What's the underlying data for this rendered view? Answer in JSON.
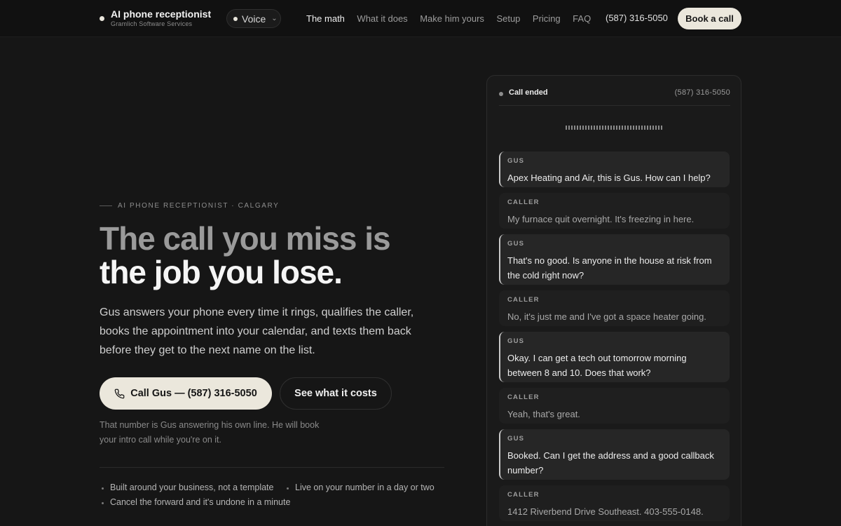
{
  "brand": {
    "title": "AI phone receptionist",
    "subtitle": "Gramlich Software Services"
  },
  "mode": {
    "label": "Voice",
    "chevron_icon": "chevron-down-icon"
  },
  "nav": {
    "links": [
      "The math",
      "What it does",
      "Make him yours",
      "Setup",
      "Pricing",
      "FAQ"
    ],
    "active": "The math",
    "phone": "(587) 316-5050",
    "book_label": "Book a call"
  },
  "hero": {
    "eyebrow": "AI PHONE RECEPTIONIST · CALGARY",
    "headline_line1": "The call you miss is",
    "headline_line2": "the job you lose.",
    "lede": "Gus answers your phone every time it rings, qualifies the caller, books the appointment into your calendar, and texts them back before they get to the next name on the list.",
    "cta_call_label": "Call Gus — (587) 316-5050",
    "cta_call_icon": "phone-icon",
    "cta_cost_label": "See what it costs",
    "note": "That number is Gus answering his own line. He will book your intro call while you're on it.",
    "bullets": [
      "Built around your business, not a template",
      "Live on your number in a day or two",
      "Cancel the forward and it's undone in a minute"
    ]
  },
  "call_card": {
    "status": "Call ended",
    "number": "(587) 316-5050",
    "messages": [
      {
        "speaker": "GUS",
        "text": "Apex Heating and Air, this is Gus. How can I help?"
      },
      {
        "speaker": "CALLER",
        "text": "My furnace quit overnight. It's freezing in here."
      },
      {
        "speaker": "GUS",
        "text": "That's no good. Is anyone in the house at risk from the cold right now?"
      },
      {
        "speaker": "CALLER",
        "text": "No, it's just me and I've got a space heater going."
      },
      {
        "speaker": "GUS",
        "text": "Okay. I can get a tech out tomorrow morning between 8 and 10. Does that work?"
      },
      {
        "speaker": "CALLER",
        "text": "Yeah, that's great."
      },
      {
        "speaker": "GUS",
        "text": "Booked. Can I get the address and a good callback number?"
      },
      {
        "speaker": "CALLER",
        "text": "1412 Riverbend Drive Southeast. 403-555-0148."
      }
    ]
  },
  "colors": {
    "background": "#161616",
    "accent_button": "#ebe7dc",
    "card": "#1a1a1a"
  }
}
